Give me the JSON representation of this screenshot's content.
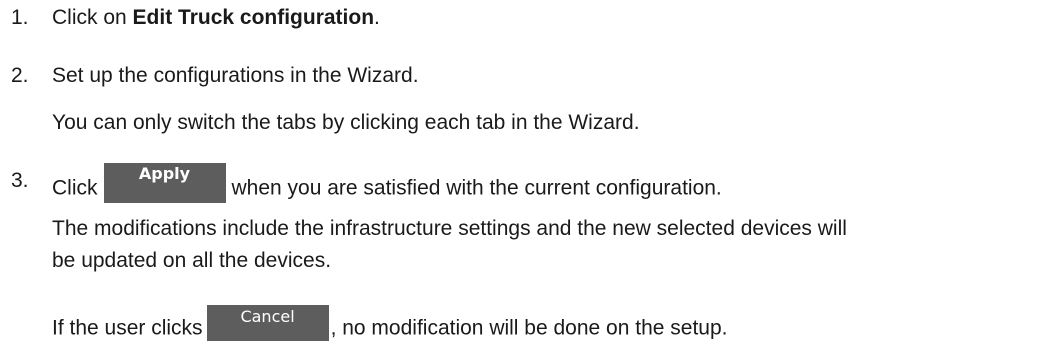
{
  "steps": [
    {
      "number": "1.",
      "text_before": "Click on ",
      "bold": "Edit Truck configuration",
      "text_after": "."
    },
    {
      "number": "2.",
      "text": "Set up the configurations in the Wizard.",
      "note": "You can only switch the tabs by clicking each tab in the Wizard."
    },
    {
      "number": "3.",
      "text_before": "Click",
      "button_label": "Apply",
      "text_after": "when you are satisfied with the current configuration.",
      "note_line1": "The modifications include the infrastructure settings and the new selected devices will",
      "note_line2": "be updated on all the devices.",
      "cancel_before": "If the user clicks",
      "cancel_label": "Cancel",
      "cancel_after": ", no modification will be done on the setup."
    }
  ],
  "colors": {
    "text": "#1a1a1a",
    "button_bg": "#5d5d5d",
    "button_text": "#ffffff"
  }
}
